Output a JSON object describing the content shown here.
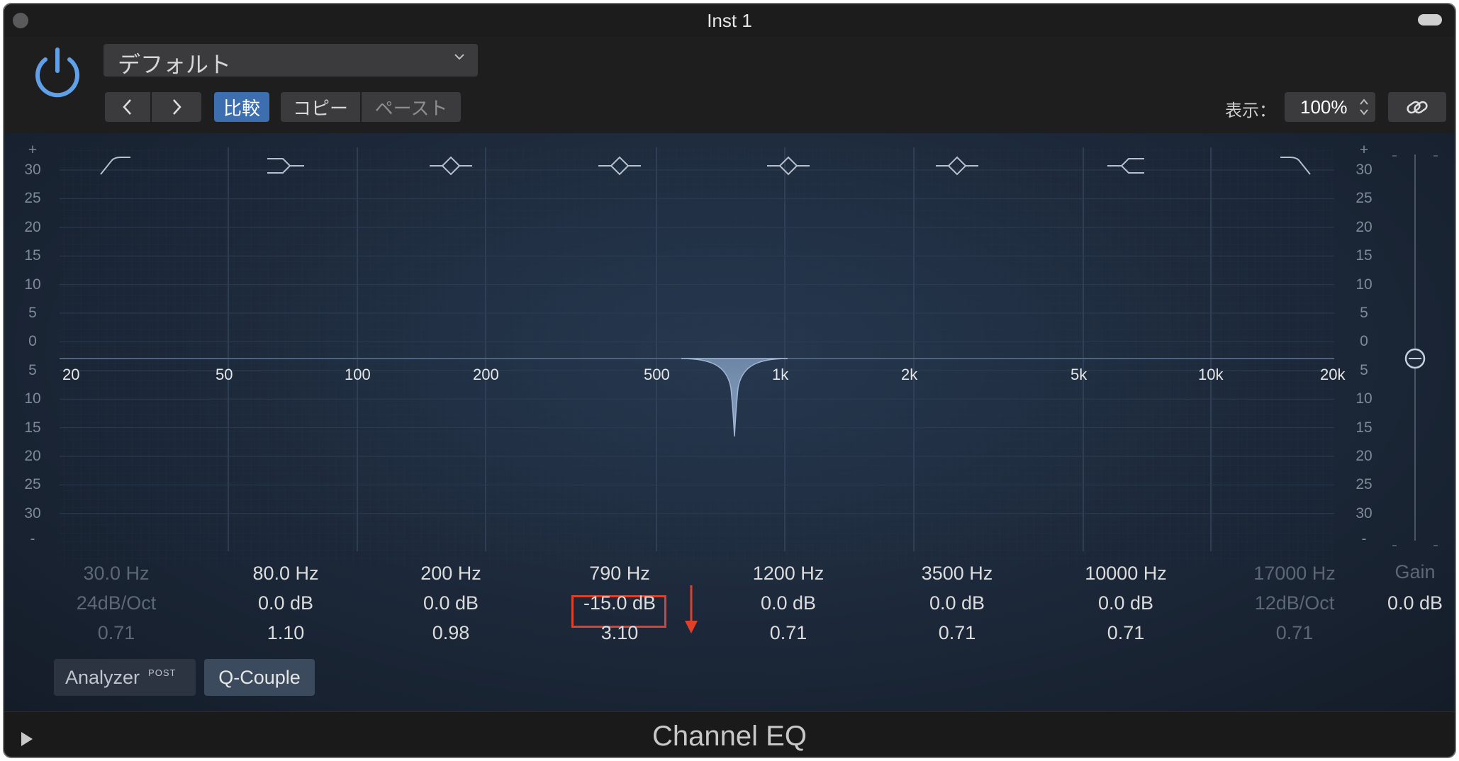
{
  "window": {
    "title": "Inst 1"
  },
  "header": {
    "preset": "デフォルト",
    "nav_prev_icon": "chevron-left-icon",
    "nav_next_icon": "chevron-right-icon",
    "compare_label": "比較",
    "copy_label": "コピー",
    "paste_label": "ペースト",
    "view_label": "表示：",
    "zoom_value": "100%"
  },
  "eq": {
    "db_plus": "+",
    "db_minus": "-",
    "db_scale_left": [
      "30",
      "25",
      "20",
      "15",
      "10",
      "5",
      "0",
      "5",
      "10",
      "15",
      "20",
      "25",
      "30"
    ],
    "db_scale_right": [
      "30",
      "25",
      "20",
      "15",
      "10",
      "5",
      "0",
      "5",
      "10",
      "15",
      "20",
      "25",
      "30"
    ],
    "freq_labels": [
      "20",
      "50",
      "100",
      "200",
      "500",
      "1k",
      "2k",
      "5k",
      "10k",
      "20k"
    ],
    "bands": [
      {
        "freq": "30.0 Hz",
        "gain": "24dB/Oct",
        "q": "0.71",
        "active": false,
        "shape": "highpass"
      },
      {
        "freq": "80.0 Hz",
        "gain": "0.0 dB",
        "q": "1.10",
        "active": true,
        "shape": "lowshelf"
      },
      {
        "freq": "200 Hz",
        "gain": "0.0 dB",
        "q": "0.98",
        "active": true,
        "shape": "bell"
      },
      {
        "freq": "790 Hz",
        "gain": "-15.0 dB",
        "q": "3.10",
        "active": true,
        "shape": "bell"
      },
      {
        "freq": "1200 Hz",
        "gain": "0.0 dB",
        "q": "0.71",
        "active": true,
        "shape": "bell"
      },
      {
        "freq": "3500 Hz",
        "gain": "0.0 dB",
        "q": "0.71",
        "active": true,
        "shape": "bell"
      },
      {
        "freq": "10000 Hz",
        "gain": "0.0 dB",
        "q": "0.71",
        "active": true,
        "shape": "highshelf"
      },
      {
        "freq": "17000 Hz",
        "gain": "12dB/Oct",
        "q": "0.71",
        "active": false,
        "shape": "lowpass"
      }
    ],
    "output_gain": {
      "label": "Gain",
      "value": "0.0 dB"
    },
    "analyzer_label": "Analyzer",
    "analyzer_badge": "POST",
    "qcouple_label": "Q-Couple",
    "accent_color": "#3d6fb0",
    "highlight_color": "#e0402a"
  },
  "footer": {
    "plugin_name": "Channel EQ"
  }
}
